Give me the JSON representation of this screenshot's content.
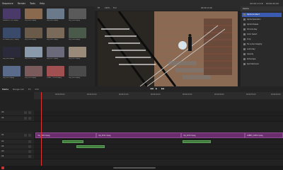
{
  "menu": {
    "items": [
      "Sequence",
      "Render",
      "Tools",
      "Help"
    ],
    "timecode": "00:00:13:18",
    "position": "00:00:00:00"
  },
  "bin": {
    "clips": [
      {
        "name": "LEAVING_CLIP1.mpeg",
        "color": "#4a3a6a"
      },
      {
        "name": "clip_0002.mpeg",
        "color": "#8a6a4e"
      },
      {
        "name": "clip_0003.mpeg",
        "color": "#6a7a8a"
      },
      {
        "name": "clip_0004.mpeg",
        "color": "#5a5a5a"
      },
      {
        "name": "FLOWERS_MG_1.mpeg",
        "color": "#3a4a6a"
      },
      {
        "name": "clip_0006.mpeg",
        "color": "#6a5a4a"
      },
      {
        "name": "clip_0007.mpeg",
        "color": "#7a6a5a"
      },
      {
        "name": "clip_0008.mpeg",
        "color": "#4a5a4a"
      },
      {
        "name": "clip_0009.mpeg",
        "color": "#2a2a3a"
      },
      {
        "name": "clip_0010.mpeg",
        "color": "#8a9aaa"
      },
      {
        "name": "clip_0011.mpeg",
        "color": "#6a6a7a"
      },
      {
        "name": "clip_0012.mpeg",
        "color": "#9a8a7a"
      },
      {
        "name": "clip_0013.mpeg",
        "color": "#5a6a8a"
      },
      {
        "name": "clip_0014.mpeg",
        "color": "#7a5a5a"
      },
      {
        "name": "LOBBY_CLIP14.mpeg",
        "color": "#a05050"
      },
      {
        "name": "clip_0016.mpeg",
        "color": "#4a4a4a"
      },
      {
        "name": "clip_0017.mpeg",
        "color": "#8a7a6a"
      },
      {
        "name": "clip_0018.mpeg",
        "color": "#6a4a3a"
      },
      {
        "name": "clip_0019.mpeg",
        "color": "#9a6a6a"
      },
      {
        "name": "clip_0020.mpeg",
        "color": "#7a6a8a"
      }
    ]
  },
  "viewer": {
    "toolbar": [
      "Fit",
      "100%",
      "Full"
    ],
    "timecode": "00:00:13:18"
  },
  "effects": {
    "title": "Alpha",
    "items": [
      "Alpha Gradient",
      "Alpha Operation",
      "Alpha Shapes",
      "Chroma Key",
      "Color Select",
      "Crop",
      "Fix Luma Integrity",
      "Luma Key",
      "Opacity",
      "Rotoscape",
      "Spot Remover"
    ],
    "selected_index": 0
  },
  "tabs": {
    "items": [
      "Media",
      "Range List",
      "FX",
      "Info"
    ],
    "active": 0
  },
  "timeline": {
    "ruler_ticks": [
      "00:00:05:00",
      "00:00:10:00",
      "00:00:15:00",
      "00:00:20:00",
      "00:00:25:00",
      "00:00:30:00",
      "00:00:35:00",
      "00:00:40:00"
    ],
    "tracks": [
      {
        "label": "V3"
      },
      {
        "label": "V2"
      },
      {
        "label": "V1"
      },
      {
        "label": "A1"
      },
      {
        "label": "A2"
      },
      {
        "label": "A3"
      },
      {
        "label": "A4"
      }
    ],
    "video_clips": [
      {
        "label": "clip_0003.mpeg"
      },
      {
        "label": "clip_0011.mpeg"
      },
      {
        "label": "clip_0015.mpeg"
      },
      {
        "label": "LOBBY_CLIP14.mpeg"
      }
    ],
    "audio_clip_labels": [
      "clip_0003.mpeg",
      "clip_0011.mpeg"
    ]
  }
}
